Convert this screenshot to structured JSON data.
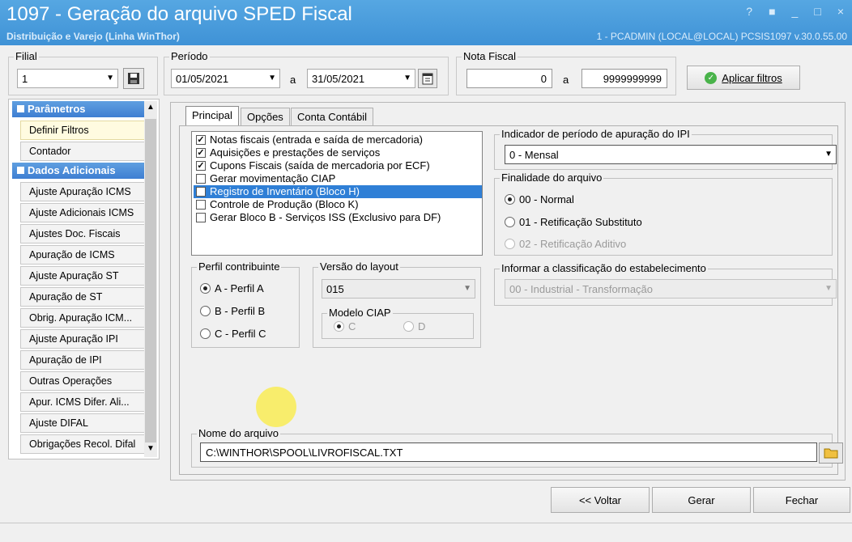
{
  "window": {
    "title": "1097 - Geração do arquivo SPED Fiscal",
    "subtitle": "Distribuição e Varejo (Linha WinThor)",
    "connection": "1 - PCADMIN (LOCAL@LOCAL)   PCSIS1097  v.30.0.55.00",
    "controls": [
      "?",
      "■",
      "_",
      "□",
      "×"
    ]
  },
  "filters": {
    "filial_label": "Filial",
    "filial_value": "1",
    "periodo_label": "Período",
    "periodo_start": "01/05/2021",
    "periodo_sep": "a",
    "periodo_end": "31/05/2021",
    "nota_label": "Nota Fiscal",
    "nota_start": "0",
    "nota_sep": "a",
    "nota_end": "9999999999",
    "apply_label": "Aplicar filtros"
  },
  "sidebar": {
    "section1": "Parâmetros",
    "section2": "Dados Adicionais",
    "items1": [
      "Definir Filtros",
      "Contador"
    ],
    "items2": [
      "Ajuste Apuração ICMS",
      "Ajuste Adicionais ICMS",
      "Ajustes Doc. Fiscais",
      "Apuração de ICMS",
      "Ajuste Apuração ST",
      "Apuração de ST",
      "Obrig. Apuração ICM...",
      "Ajuste Apuração IPI",
      "Apuração de IPI",
      "Outras Operações",
      "Apur. ICMS Difer. Ali...",
      "Ajuste DIFAL",
      "Obrigações Recol. Difal"
    ]
  },
  "tabs": [
    "Principal",
    "Opções",
    "Conta Contábil"
  ],
  "checklist": [
    {
      "label": "Notas fiscais (entrada e saída de mercadoria)",
      "checked": true
    },
    {
      "label": "Aquisições e prestações de serviços",
      "checked": true
    },
    {
      "label": "Cupons Fiscais (saída de mercadoria por ECF)",
      "checked": true
    },
    {
      "label": "Gerar movimentação CIAP",
      "checked": false
    },
    {
      "label": "Registro de Inventário (Bloco H)",
      "checked": false
    },
    {
      "label": "Controle de Produção (Bloco K)",
      "checked": false
    },
    {
      "label": "Gerar Bloco B - Serviços ISS (Exclusivo para DF)",
      "checked": false
    }
  ],
  "ipi": {
    "label": "Indicador de período de apuração do IPI",
    "value": "0 - Mensal"
  },
  "finalidade": {
    "label": "Finalidade do arquivo",
    "options": [
      "00 - Normal",
      "01 - Retificação Substituto",
      "02 - Retificação Aditivo"
    ]
  },
  "perfil": {
    "label": "Perfil contribuinte",
    "options": [
      "A - Perfil A",
      "B - Perfil B",
      "C - Perfil C"
    ]
  },
  "layout": {
    "label": "Versão do layout",
    "value": "015",
    "ciap_label": "Modelo CIAP",
    "ciap_options": [
      "C",
      "D"
    ]
  },
  "classificacao": {
    "label": "Informar a classificação do estabelecimento",
    "value": "00 - Industrial - Transformação"
  },
  "arquivo": {
    "label": "Nome do arquivo",
    "value": "C:\\WINTHOR\\SPOOL\\LIVROFISCAL.TXT"
  },
  "footer": {
    "back": "<< Voltar",
    "generate": "Gerar",
    "close": "Fechar"
  }
}
